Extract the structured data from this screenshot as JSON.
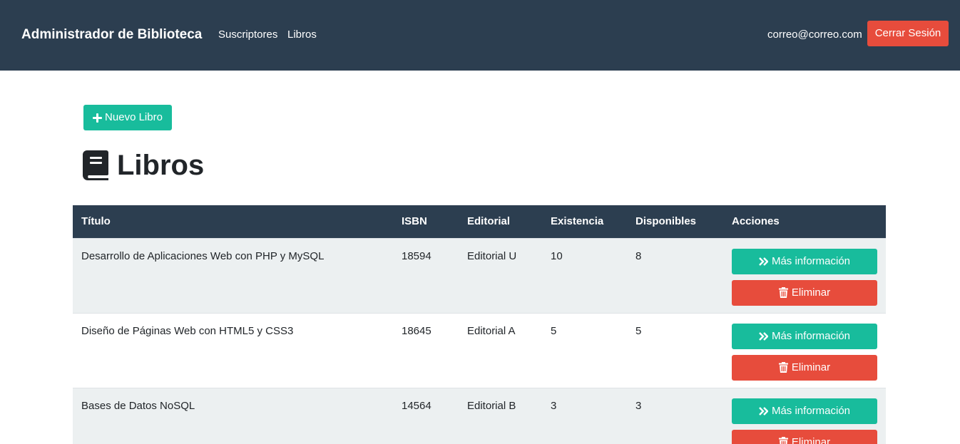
{
  "navbar": {
    "brand": "Administrador de Biblioteca",
    "links": [
      "Suscriptores",
      "Libros"
    ],
    "user_email": "correo@correo.com",
    "logout_label": "Cerrar Sesión"
  },
  "main": {
    "new_book_label": "Nuevo Libro",
    "page_title": "Libros"
  },
  "table": {
    "headers": [
      "Título",
      "ISBN",
      "Editorial",
      "Existencia",
      "Disponibles",
      "Acciones"
    ],
    "rows": [
      {
        "titulo": "Desarrollo de Aplicaciones Web con PHP y MySQL",
        "isbn": "18594",
        "editorial": "Editorial U",
        "existencia": "10",
        "disponibles": "8"
      },
      {
        "titulo": "Diseño de Páginas Web con HTML5 y CSS3",
        "isbn": "18645",
        "editorial": "Editorial A",
        "existencia": "5",
        "disponibles": "5"
      },
      {
        "titulo": "Bases de Datos NoSQL",
        "isbn": "14564",
        "editorial": "Editorial B",
        "existencia": "3",
        "disponibles": "3"
      }
    ],
    "info_label": "Más información",
    "delete_label": "Eliminar"
  },
  "colors": {
    "navbar": "#2c3e50",
    "primary_success": "#18bc9c",
    "danger": "#e74c3c",
    "stripe": "#ecf0f1"
  },
  "icons": {
    "new_book": "plus-icon",
    "title": "book-icon",
    "info": "double-chevron-right-icon",
    "delete": "trash-icon"
  }
}
